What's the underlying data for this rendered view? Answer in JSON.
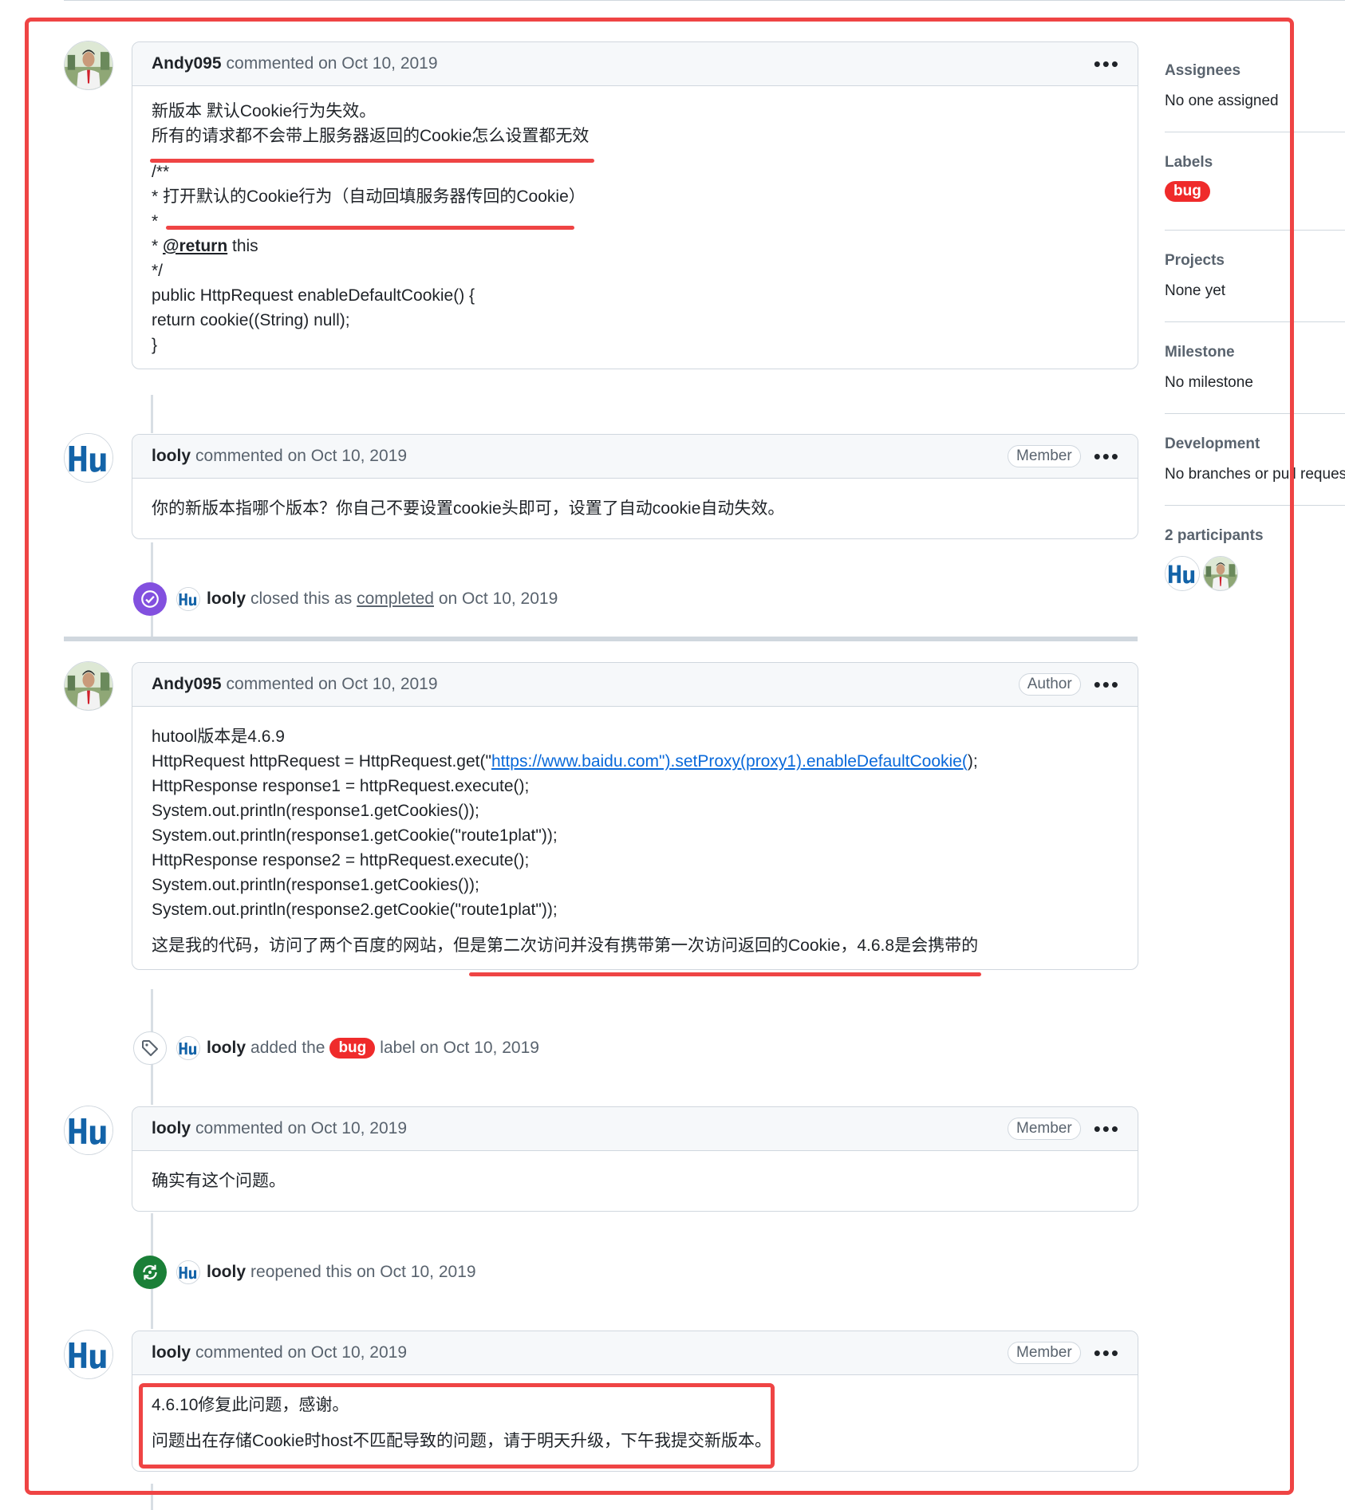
{
  "comments": [
    {
      "author": "Andy095",
      "meta": "commented on Oct 10, 2019",
      "role": "",
      "lines": [
        "新版本 默认Cookie行为失效。",
        "所有的请求都不会带上服务器返回的Cookie怎么设置都无效",
        "/**",
        "* 打开默认的Cookie行为（自动回填服务器传回的Cookie）",
        "*",
        "* @return this",
        "*/",
        "public HttpRequest enableDefaultCookie() {",
        "return cookie((String) null);",
        "}"
      ]
    },
    {
      "author": "looly",
      "meta": "commented on Oct 10, 2019",
      "role": "Member",
      "lines": [
        "你的新版本指哪个版本？你自己不要设置cookie头即可，设置了自动cookie自动失效。"
      ]
    },
    {
      "author": "Andy095",
      "meta": "commented on Oct 10, 2019",
      "role": "Author",
      "lines": [
        "hutool版本是4.6.9",
        "HttpRequest httpRequest = HttpRequest.get(\"https://www.baidu.com\").setProxy(proxy1).enableDefaultCookie();",
        "HttpResponse response1 = httpRequest.execute();",
        "System.out.println(response1.getCookies());",
        "System.out.println(response1.getCookie(\"route1plat\"));",
        "HttpResponse response2 = httpRequest.execute();",
        "System.out.println(response1.getCookies());",
        "System.out.println(response2.getCookie(\"route1plat\"));",
        "这是我的代码，访问了两个百度的网站，但是第二次访问并没有携带第一次访问返回的Cookie，4.6.8是会携带的"
      ]
    },
    {
      "author": "looly",
      "meta": "commented on Oct 10, 2019",
      "role": "Member",
      "lines": [
        "确实有这个问题。"
      ]
    },
    {
      "author": "looly",
      "meta": "commented on Oct 10, 2019",
      "role": "Member",
      "lines": [
        "4.6.10修复此问题，感谢。",
        "问题出在存储Cookie时host不匹配导致的问题，请于明天升级，下午我提交新版本。"
      ]
    }
  ],
  "c1": {
    "mention": "@return",
    "after": " this"
  },
  "c3": {
    "code_prefix": "HttpRequest httpRequest = HttpRequest.get(\"",
    "code_link": "https://www.baidu.com\").setProxy(proxy1).enableDefaultCookie(",
    "code_suffix": ");"
  },
  "events": [
    {
      "actor": "looly",
      "pre": "closed this as",
      "word": "completed",
      "post": "on Oct 10, 2019",
      "color": "#8250df",
      "icon": "check-circle-icon"
    },
    {
      "actor": "looly",
      "pre": "added the",
      "label": "bug",
      "post": "label on Oct 10, 2019",
      "color": "#59636e",
      "icon": "tag-icon"
    },
    {
      "actor": "looly",
      "pre": "reopened this on Oct 10, 2019",
      "color": "#1a7f37",
      "icon": "sync-icon"
    }
  ],
  "sidebar": {
    "assignees_title": "Assignees",
    "assignees_value": "No one assigned",
    "labels_title": "Labels",
    "label": "bug",
    "projects_title": "Projects",
    "projects_value": "None yet",
    "milestone_title": "Milestone",
    "milestone_value": "No milestone",
    "development_title": "Development",
    "development_value": "No branches or pull requests",
    "participants_title": "2 participants"
  },
  "colors": {
    "accent_red": "#ef4444",
    "label_bug": "#ef2b2b",
    "link": "#0969da",
    "closed_purple": "#8250df",
    "reopen_green": "#1a7f37"
  }
}
